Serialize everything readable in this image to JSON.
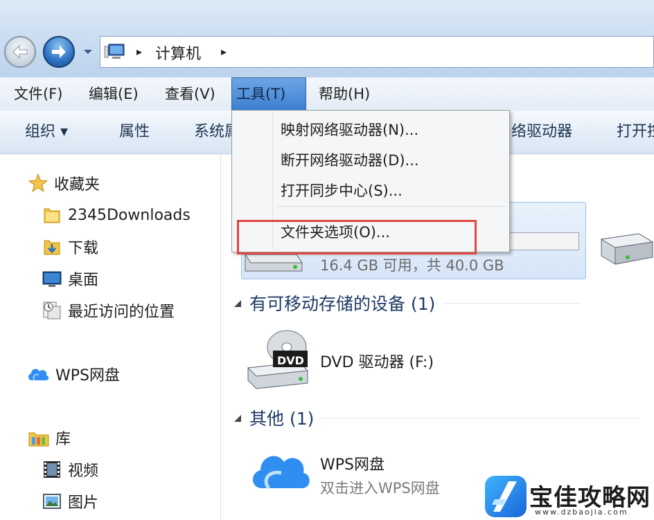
{
  "address": {
    "crumbs": [
      "计算机"
    ],
    "separators": [
      "▸",
      "▸"
    ]
  },
  "menubar": {
    "items": [
      {
        "label": "文件(F)"
      },
      {
        "label": "编辑(E)"
      },
      {
        "label": "查看(V)"
      },
      {
        "label": "工具(T)",
        "active": true
      },
      {
        "label": "帮助(H)"
      }
    ]
  },
  "toolbar": {
    "organize": "组织 ▾",
    "properties": "属性",
    "system": "系统属",
    "map_drive_partial": "络驱动器",
    "open_partial": "打开控"
  },
  "tools_menu": {
    "items": [
      {
        "label": "映射网络驱动器(N)..."
      },
      {
        "label": "断开网络驱动器(D)..."
      },
      {
        "label": "打开同步中心(S)..."
      },
      {
        "label": "文件夹选项(O)..."
      }
    ]
  },
  "navpane": {
    "favorites": "收藏夹",
    "favorites_items": [
      "2345Downloads",
      "下载",
      "桌面",
      "最近访问的位置"
    ],
    "wps": "WPS网盘",
    "library": "库",
    "library_items": [
      "视频",
      "图片"
    ]
  },
  "content": {
    "drive_c_free": "16.4 GB 可用，共 40.0 GB",
    "removable_header": "有可移动存储的设备 (1)",
    "dvd_label": "DVD 驱动器 (F:)",
    "dvd_badge": "DVD",
    "other_header": "其他 (1)",
    "wps_title": "WPS网盘",
    "wps_sub": "双击进入WPS网盘"
  },
  "watermark": {
    "name": "宝佳攻略网",
    "url": "www.dzbaojia.com"
  },
  "colors": {
    "menu_active": "#3d7fcf",
    "highlight_box": "#e0473f",
    "section_header": "#1e3a66"
  }
}
